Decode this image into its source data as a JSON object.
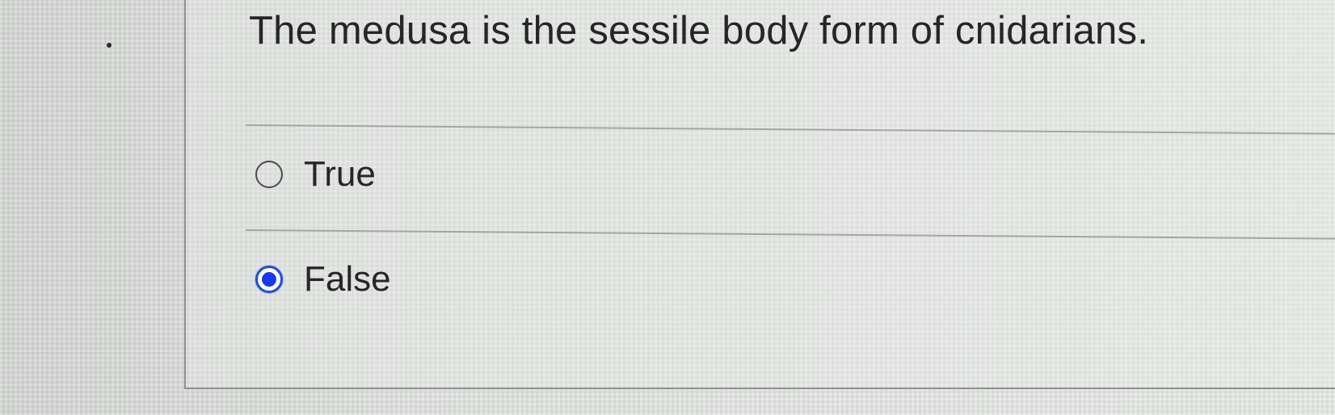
{
  "question": {
    "text": "The medusa is the sessile body form of cnidarians."
  },
  "options": [
    {
      "label": "True",
      "selected": false
    },
    {
      "label": "False",
      "selected": true
    }
  ],
  "colors": {
    "selected_radio": "#1a39e8",
    "text": "#262626",
    "divider": "#a3a6a3"
  }
}
